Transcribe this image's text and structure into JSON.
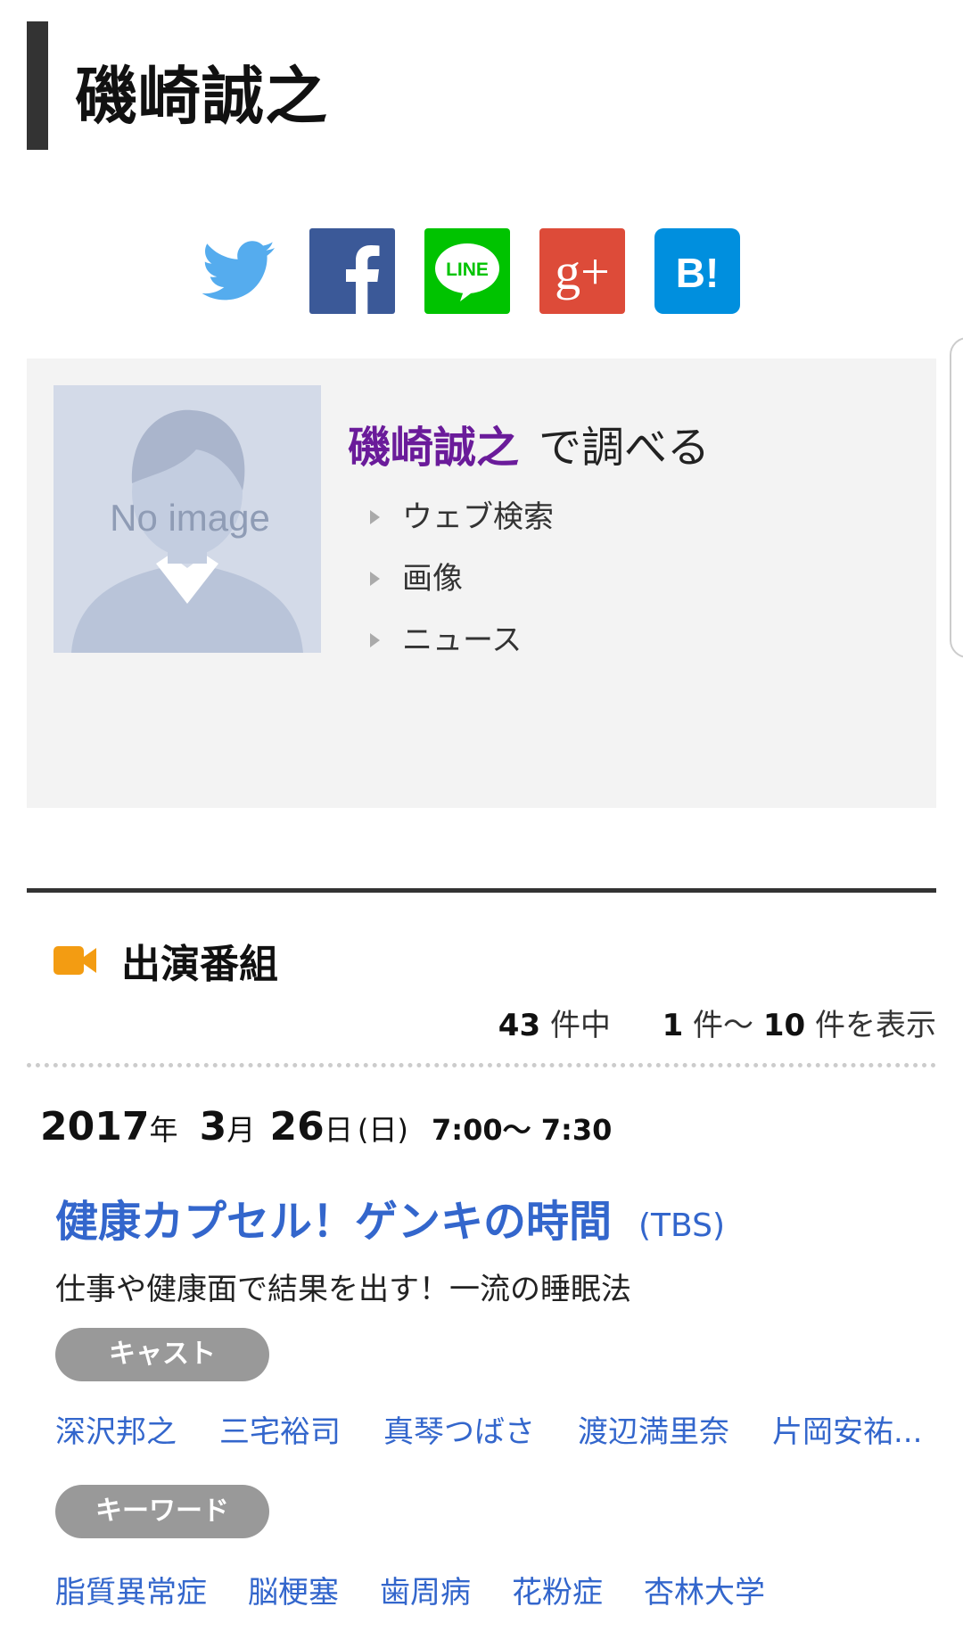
{
  "person": {
    "name": "磯崎誠之"
  },
  "share": {
    "twitter_icon": "twitter-icon",
    "facebook_icon": "facebook-icon",
    "line_label": "LINE",
    "gplus_label": "g+",
    "hatena_label": "B!"
  },
  "search_box": {
    "no_image_text": "No image",
    "name": "磯崎誠之",
    "suffix": "で調べる",
    "links": [
      "ウェブ検索",
      "画像",
      "ニュース"
    ]
  },
  "programs": {
    "heading": "出演番組",
    "total": "43",
    "total_suffix": "件中",
    "range_start": "1",
    "range_mid": "件〜",
    "range_end": "10",
    "range_suffix": "件を表示",
    "item": {
      "year": "2017",
      "year_unit": "年",
      "month": "3",
      "month_unit": "月",
      "day": "26",
      "day_unit": "日",
      "weekday": "(日)",
      "time": "7:00〜 7:30",
      "title": "健康カプセル！ゲンキの時間",
      "channel": "(TBS)",
      "description": "仕事や健康面で結果を出す！一流の睡眠法",
      "cast_label": "キャスト",
      "cast": [
        "深沢邦之",
        "三宅裕司",
        "真琴つばさ",
        "渡辺満里奈",
        "片岡安祐..."
      ],
      "keyword_label": "キーワード",
      "keywords": [
        "脂質異常症",
        "脳梗塞",
        "歯周病",
        "花粉症",
        "杏林大学"
      ]
    }
  },
  "colors": {
    "link": "#3366cc",
    "name_accent": "#6a1b9a",
    "section_icon": "#f39c12",
    "pill": "#999999"
  }
}
